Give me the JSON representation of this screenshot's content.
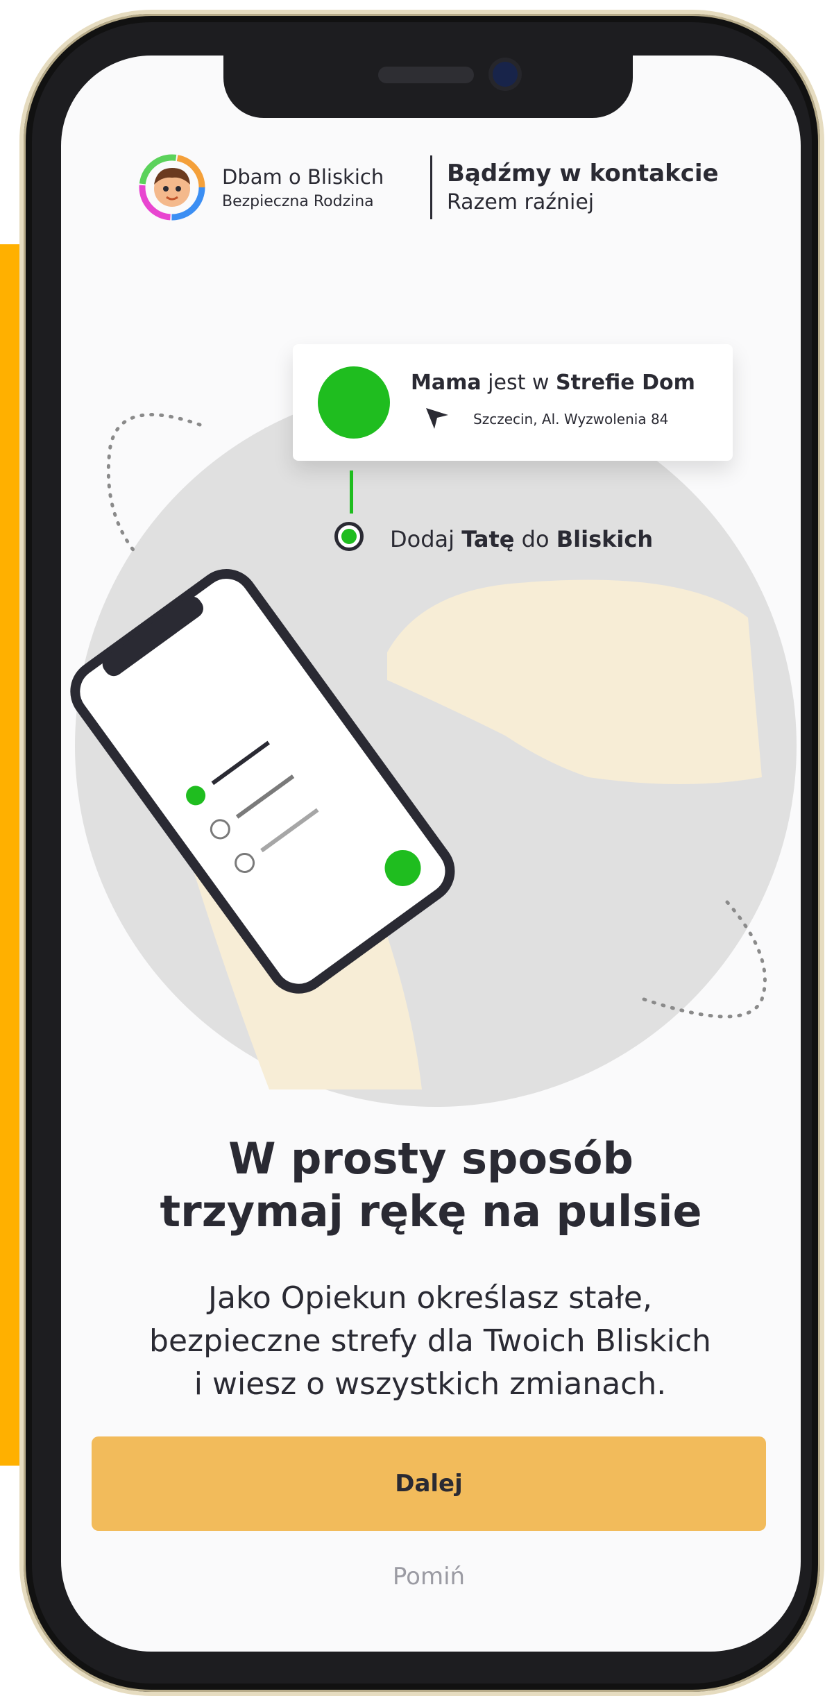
{
  "brand": {
    "name": "Dbam o Bliskich",
    "subtitle": "Bezpieczna Rodzina",
    "tagline_title": "Bądźmy w kontakcie",
    "tagline_sub": "Razem raźniej"
  },
  "status_card": {
    "person": "Mama",
    "verb": "jest w",
    "zone": "Strefie Dom",
    "address": "Szczecin, Al. Wyzwolenia 84",
    "status_color": "#1fbd1f"
  },
  "add_relative": {
    "prefix": "Dodaj",
    "person": "Tatę",
    "middle": "do",
    "group": "Bliskich"
  },
  "headline": {
    "line1": "W prosty sposób",
    "line2": "trzymaj rękę na pulsie"
  },
  "body": {
    "line1": "Jako Opiekun określasz stałe,",
    "line2": "bezpieczne strefy dla Twoich Bliskich",
    "line3": "i wiesz o wszystkich zmianach."
  },
  "actions": {
    "next_label": "Dalej",
    "skip_label": "Pomiń"
  },
  "colors": {
    "accent": "#f2bb5b",
    "green": "#1fbd1f",
    "backdrop": "#ffb000"
  }
}
